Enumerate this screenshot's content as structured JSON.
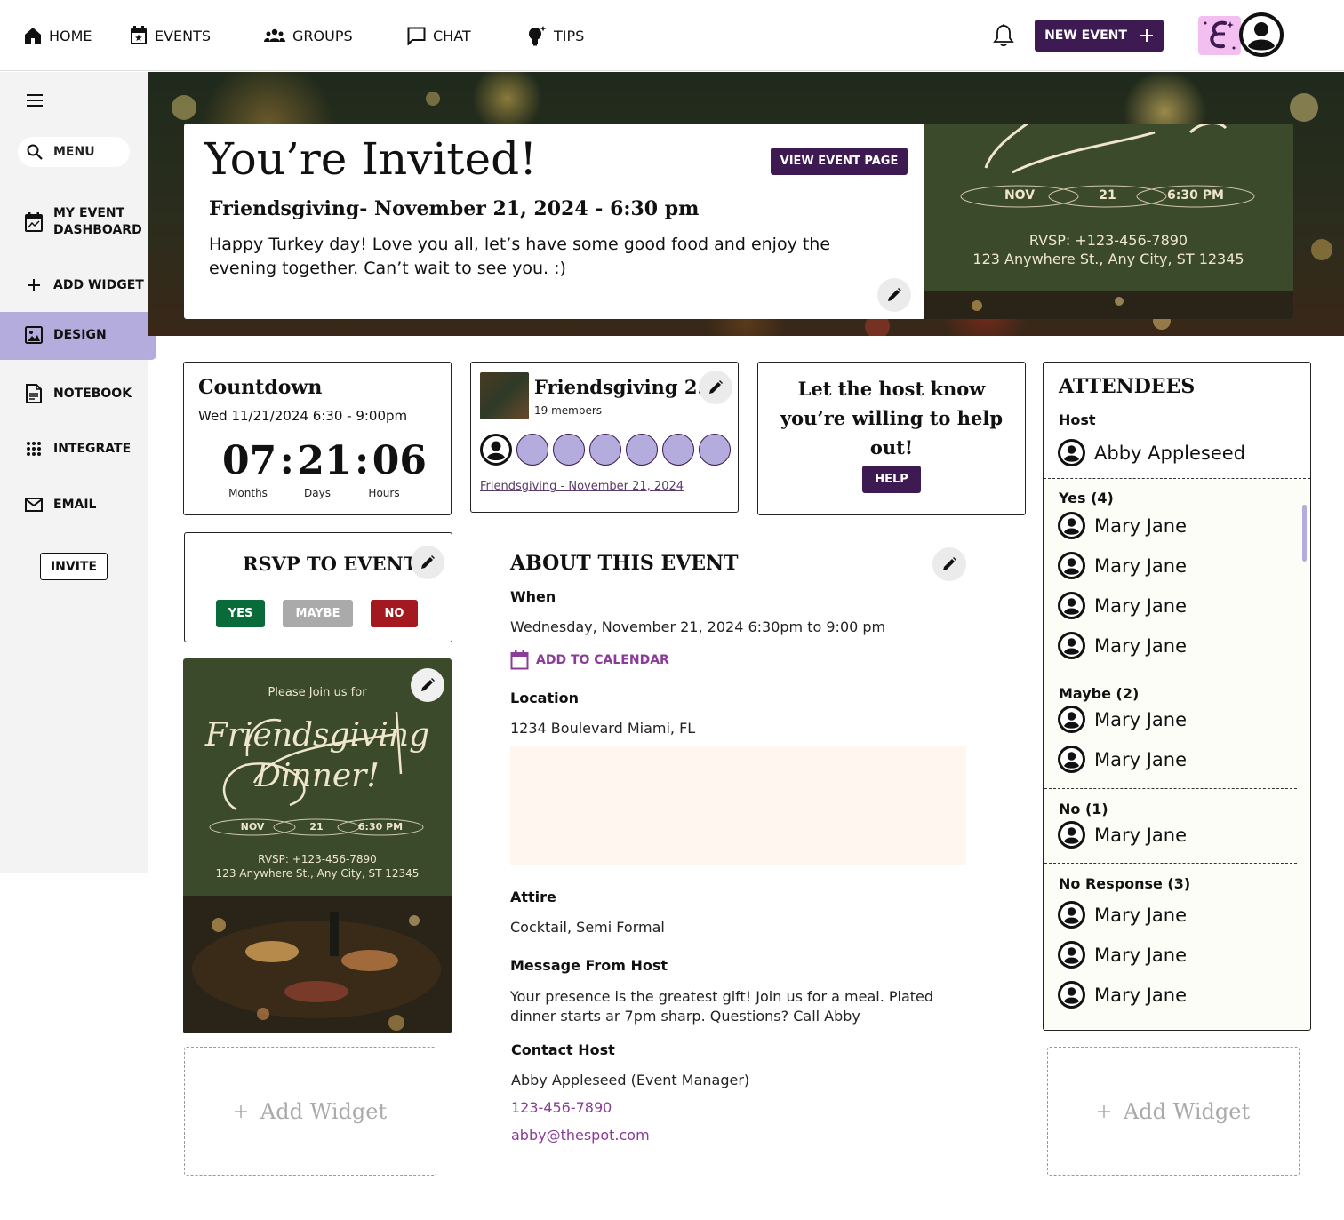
{
  "nav": {
    "home": "HOME",
    "events": "EVENTS",
    "groups": "GROUPS",
    "chat": "CHAT",
    "tips": "TIPS",
    "new_event": "NEW EVENT"
  },
  "sidebar": {
    "search_label": "MENU",
    "items": [
      {
        "label_1": "MY EVENT",
        "label_2": "DASHBOARD"
      },
      {
        "label": "ADD WIDGET"
      },
      {
        "label": "DESIGN"
      },
      {
        "label": "NOTEBOOK"
      },
      {
        "label": "INTEGRATE"
      },
      {
        "label": "EMAIL"
      }
    ],
    "invite": "INVITE"
  },
  "invite": {
    "title": "You’re Invited!",
    "view_event": "VIEW EVENT PAGE",
    "subtitle": "Friendsgiving- November 21, 2024  - 6:30 pm",
    "message": "Happy Turkey day! Love you all, let’s have some good food and enjoy the evening together. Can’t wait to see you. :)"
  },
  "flyer": {
    "intro": "Please Join us for",
    "script_1": "Friendsgiving",
    "script_2": "Dinner!",
    "month": "NOV",
    "day": "21",
    "time": "6:30 PM",
    "rsvp": "RVSP: +123-456-7890",
    "address": "123 Anywhere St., Any City, ST 12345"
  },
  "countdown": {
    "title": "Countdown",
    "when": "Wed 11/21/2024 6:30 - 9:00pm",
    "months": "07",
    "days": "21",
    "hours": "06",
    "sep": ":",
    "months_label": "Months",
    "days_label": "Days",
    "hours_label": "Hours"
  },
  "group": {
    "name": "Friendsgiving 2...",
    "members": "19 members",
    "link": "Friendsgiving - November 21, 2024"
  },
  "help": {
    "text": "Let the host know you’re willing to help out!",
    "button": "HELP"
  },
  "rsvp": {
    "title": "RSVP TO EVENT",
    "yes": "YES",
    "maybe": "MAYBE",
    "no": "NO"
  },
  "about": {
    "title": "ABOUT THIS EVENT",
    "when_label": "When",
    "when_value": "Wednesday, November 21, 2024 6:30pm to 9:00 pm",
    "add_calendar": "ADD TO CALENDAR",
    "location_label": "Location",
    "location_value": "1234 Boulevard Miami, FL",
    "attire_label": "Attire",
    "attire_value": "Cocktail, Semi Formal",
    "message_label": "Message From Host",
    "message_value": "Your presence is the greatest gift! Join us for a meal. Plated dinner starts ar 7pm sharp. Questions? Call Abby",
    "contact_label": "Contact Host",
    "contact_name": "Abby Appleseed (Event Manager)",
    "contact_phone": "123-456-7890",
    "contact_email": "abby@thespot.com"
  },
  "attendees": {
    "title": "ATTENDEES",
    "host_label": "Host",
    "host": "Abby Appleseed",
    "yes_label": "Yes (4)",
    "yes": [
      "Mary Jane",
      "Mary Jane",
      "Mary Jane",
      "Mary Jane"
    ],
    "maybe_label": "Maybe (2)",
    "maybe": [
      "Mary Jane",
      "Mary Jane"
    ],
    "no_label": "No (1)",
    "no": [
      "Mary Jane"
    ],
    "noresp_label": "No Response (3)",
    "noresp": [
      "Mary Jane",
      "Mary Jane",
      "Mary Jane"
    ]
  },
  "widgets": {
    "add_left": "Add Widget",
    "add_right": "Add Widget"
  },
  "colors": {
    "brand": "#3d1a52",
    "active": "#b4acdd",
    "yes": "#0a6b3a",
    "maybe": "#aaaaaa",
    "no": "#a3191f",
    "link": "#8a3c98"
  },
  "icons": [
    "home-icon",
    "calendar-star-icon",
    "groups-icon",
    "chat-icon",
    "lightbulb-icon",
    "bell-icon",
    "plus-icon",
    "user-icon",
    "hamburger-icon",
    "search-icon",
    "dashboard-icon",
    "image-icon",
    "notebook-icon",
    "grid-icon",
    "mail-icon",
    "pencil-icon",
    "calendar-icon"
  ]
}
